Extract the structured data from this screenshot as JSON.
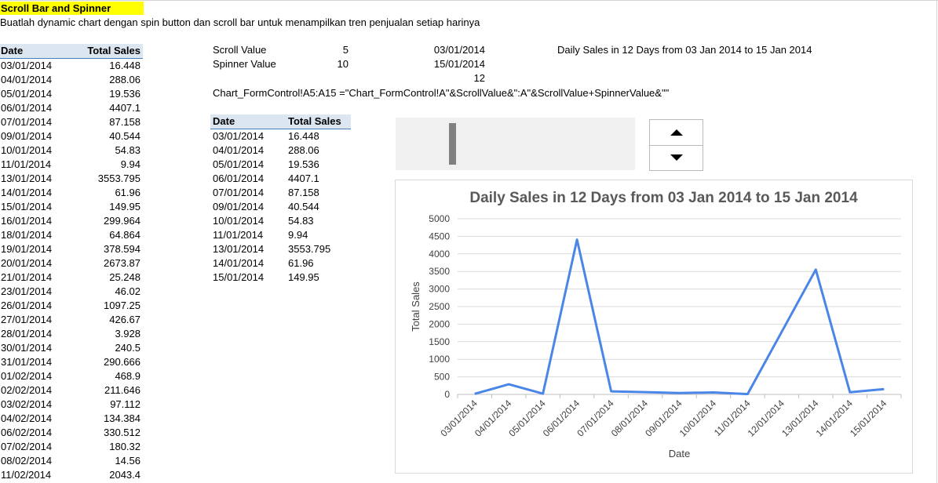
{
  "sheet": {
    "title": "Scroll Bar and Spinner",
    "subtitle": "Buatlah dynamic chart dengan spin button dan scroll bar untuk menampilkan tren penjualan setiap harinya"
  },
  "controls": {
    "scroll_label": "Scroll Value",
    "scroll_value": "5",
    "spinner_label": "Spinner Value",
    "spinner_value": "10",
    "start_date": "03/01/2014",
    "end_date": "15/01/2014",
    "day_count": "12",
    "chart_title_cell": "Daily Sales in 12 Days from 03 Jan 2014 to 15 Jan 2014",
    "formula_ref": "Chart_FormControl!A5:A15",
    "formula": "=\"Chart_FormControl!A\"&ScrollValue&\":A\"&ScrollValue+SpinnerValue&\"\""
  },
  "left_table": {
    "headers": [
      "Date",
      "Total Sales"
    ],
    "rows": [
      [
        "03/01/2014",
        "16.448"
      ],
      [
        "04/01/2014",
        "288.06"
      ],
      [
        "05/01/2014",
        "19.536"
      ],
      [
        "06/01/2014",
        "4407.1"
      ],
      [
        "07/01/2014",
        "87.158"
      ],
      [
        "09/01/2014",
        "40.544"
      ],
      [
        "10/01/2014",
        "54.83"
      ],
      [
        "11/01/2014",
        "9.94"
      ],
      [
        "13/01/2014",
        "3553.795"
      ],
      [
        "14/01/2014",
        "61.96"
      ],
      [
        "15/01/2014",
        "149.95"
      ],
      [
        "16/01/2014",
        "299.964"
      ],
      [
        "18/01/2014",
        "64.864"
      ],
      [
        "19/01/2014",
        "378.594"
      ],
      [
        "20/01/2014",
        "2673.87"
      ],
      [
        "21/01/2014",
        "25.248"
      ],
      [
        "23/01/2014",
        "46.02"
      ],
      [
        "26/01/2014",
        "1097.25"
      ],
      [
        "27/01/2014",
        "426.67"
      ],
      [
        "28/01/2014",
        "3.928"
      ],
      [
        "30/01/2014",
        "240.5"
      ],
      [
        "31/01/2014",
        "290.666"
      ],
      [
        "01/02/2014",
        "468.9"
      ],
      [
        "02/02/2014",
        "211.646"
      ],
      [
        "03/02/2014",
        "97.112"
      ],
      [
        "04/02/2014",
        "134.384"
      ],
      [
        "06/02/2014",
        "330.512"
      ],
      [
        "07/02/2014",
        "180.32"
      ],
      [
        "08/02/2014",
        "14.56"
      ],
      [
        "11/02/2014",
        "2043.4"
      ]
    ]
  },
  "mid_table": {
    "headers": [
      "Date",
      "Total Sales"
    ],
    "rows": [
      [
        "03/01/2014",
        "16.448"
      ],
      [
        "04/01/2014",
        "288.06"
      ],
      [
        "05/01/2014",
        "19.536"
      ],
      [
        "06/01/2014",
        "4407.1"
      ],
      [
        "07/01/2014",
        "87.158"
      ],
      [
        "09/01/2014",
        "40.544"
      ],
      [
        "10/01/2014",
        "54.83"
      ],
      [
        "11/01/2014",
        "9.94"
      ],
      [
        "13/01/2014",
        "3553.795"
      ],
      [
        "14/01/2014",
        "61.96"
      ],
      [
        "15/01/2014",
        "149.95"
      ]
    ]
  },
  "chart_data": {
    "type": "line",
    "title": "Daily Sales in 12 Days from 03 Jan 2014 to 15 Jan 2014",
    "xlabel": "Date",
    "ylabel": "Total Sales",
    "categories": [
      "03/01/2014",
      "04/01/2014",
      "05/01/2014",
      "06/01/2014",
      "07/01/2014",
      "08/01/2014",
      "09/01/2014",
      "10/01/2014",
      "11/01/2014",
      "12/01/2014",
      "13/01/2014",
      "14/01/2014",
      "15/01/2014"
    ],
    "values": [
      16.448,
      288.06,
      19.536,
      4407.1,
      87.158,
      63.851,
      40.544,
      54.83,
      9.94,
      1781.8675,
      3553.795,
      61.96,
      149.95
    ],
    "ylim": [
      0,
      5000
    ],
    "yticks": [
      "0",
      "500",
      "1000",
      "1500",
      "2000",
      "2500",
      "3000",
      "3500",
      "4000",
      "4500",
      "5000"
    ],
    "grid": true,
    "line_color": "#4a86e8"
  }
}
